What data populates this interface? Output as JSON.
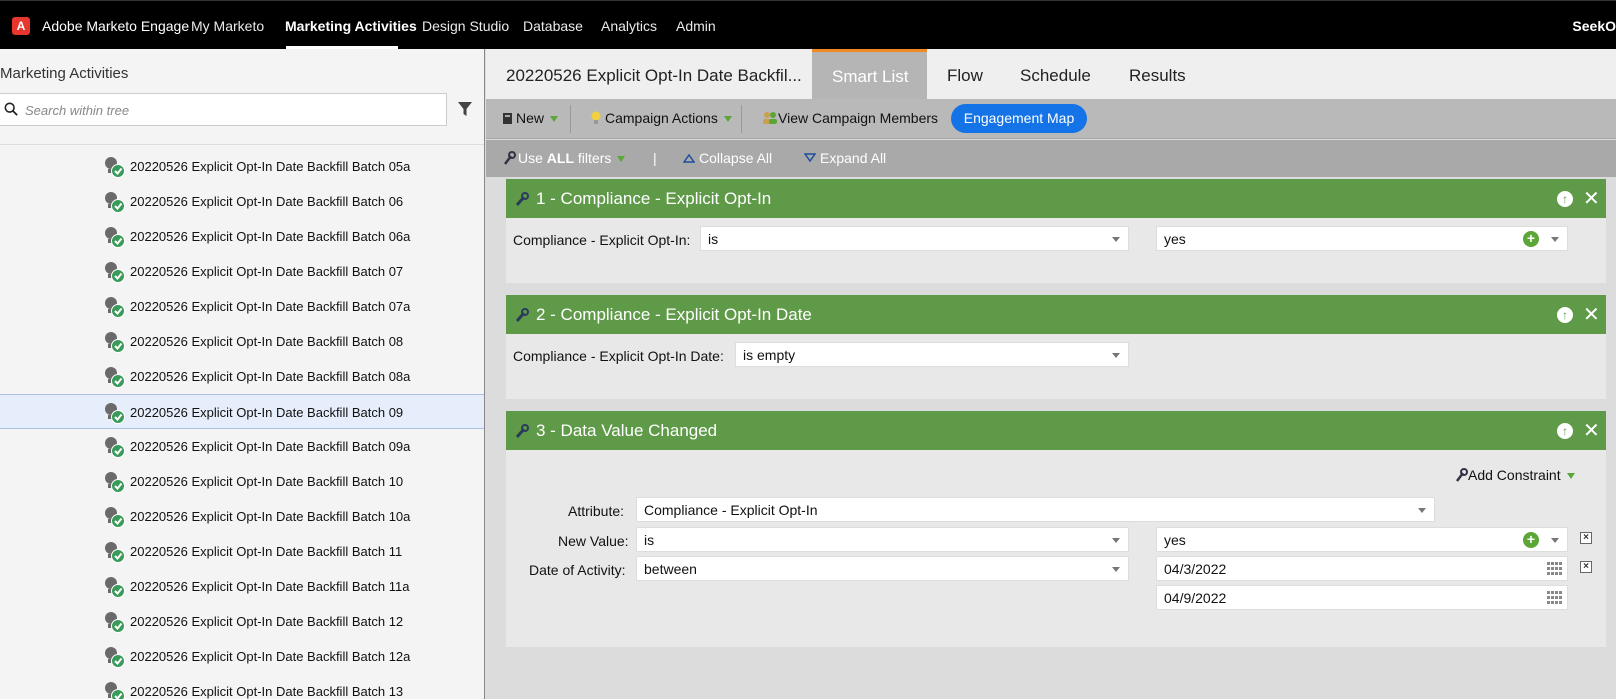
{
  "nav": {
    "brand": "Adobe Marketo Engage",
    "items": [
      "My Marketo",
      "Marketing Activities",
      "Design Studio",
      "Database",
      "Analytics",
      "Admin"
    ],
    "user": "SeekO"
  },
  "left": {
    "title": "Marketing Activities",
    "search_placeholder": "Search within tree",
    "items": [
      "20220526 Explicit Opt-In Date Backfill Batch 05a",
      "20220526 Explicit Opt-In Date Backfill Batch 06",
      "20220526 Explicit Opt-In Date Backfill Batch 06a",
      "20220526 Explicit Opt-In Date Backfill Batch 07",
      "20220526 Explicit Opt-In Date Backfill Batch 07a",
      "20220526 Explicit Opt-In Date Backfill Batch 08",
      "20220526 Explicit Opt-In Date Backfill Batch 08a",
      "20220526 Explicit Opt-In Date Backfill Batch 09",
      "20220526 Explicit Opt-In Date Backfill Batch 09a",
      "20220526 Explicit Opt-In Date Backfill Batch 10",
      "20220526 Explicit Opt-In Date Backfill Batch 10a",
      "20220526 Explicit Opt-In Date Backfill Batch 11",
      "20220526 Explicit Opt-In Date Backfill Batch 11a",
      "20220526 Explicit Opt-In Date Backfill Batch 12",
      "20220526 Explicit Opt-In Date Backfill Batch 12a",
      "20220526 Explicit Opt-In Date Backfill Batch 13"
    ],
    "selected_index": 7
  },
  "tabs": {
    "title": "20220526 Explicit Opt-In Date Backfil...",
    "smart_list": "Smart List",
    "flow": "Flow",
    "schedule": "Schedule",
    "results": "Results"
  },
  "toolbar": {
    "new": "New",
    "campaign_actions": "Campaign Actions",
    "view_members": "View Campaign Members",
    "engagement_map": "Engagement Map"
  },
  "filterbar": {
    "use_prefix": "Use ",
    "use_all": "ALL",
    "use_suffix": " filters",
    "divider": "|",
    "collapse": "Collapse All",
    "expand": "Expand All"
  },
  "filters": {
    "f1": {
      "title": "1 - Compliance - Explicit Opt-In",
      "label": "Compliance - Explicit Opt-In:",
      "operator": "is",
      "value": "yes"
    },
    "f2": {
      "title": "2 - Compliance - Explicit Opt-In Date",
      "label": "Compliance - Explicit Opt-In Date:",
      "operator": "is empty"
    },
    "f3": {
      "title": "3 - Data Value Changed",
      "add_constraint": "Add Constraint",
      "attribute_label": "Attribute:",
      "attribute_value": "Compliance - Explicit Opt-In",
      "new_value_label": "New Value:",
      "new_value_operator": "is",
      "new_value_value": "yes",
      "date_label": "Date of Activity:",
      "date_operator": "between",
      "date_from": "04/3/2022",
      "date_to": "04/9/2022"
    }
  },
  "colors": {
    "filter_header": "#5f9a48",
    "accent_tab": "#f08a24",
    "engagement_button": "#1473e6"
  }
}
